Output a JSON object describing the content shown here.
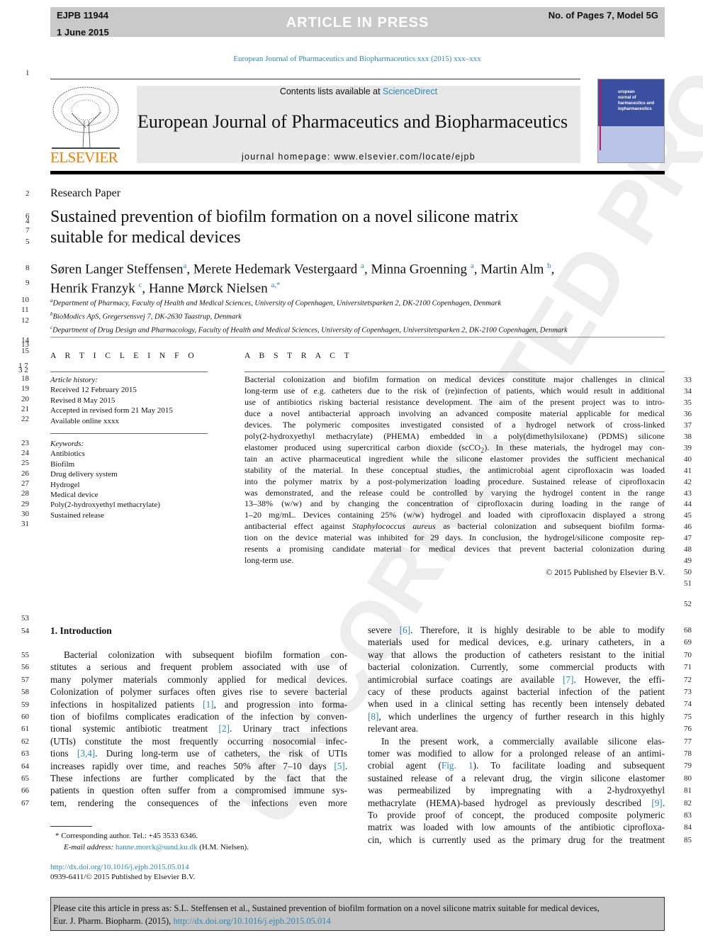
{
  "header": {
    "code": "EJPB 11944",
    "date": "1 June 2015",
    "status": "ARTICLE IN PRESS",
    "pages": "No. of Pages 7, Model 5G"
  },
  "journal_ref": "European Journal of Pharmaceutics and Biopharmaceutics xxx (2015) xxx–xxx",
  "masthead": {
    "contents_prefix": "Contents lists available at ",
    "sciencedirect": "ScienceDirect",
    "journal_name": "European Journal of Pharmaceutics and Biopharmaceutics",
    "homepage": "journal homepage: www.elsevier.com/locate/ejpb",
    "publisher_logo": "ELSEVIER",
    "cover_title": [
      "uropean",
      "ournal of",
      "harmaceutics and",
      "iopharmaceutics"
    ]
  },
  "colors": {
    "link": "#2a87b8",
    "elsevier_orange": "#f07d00",
    "cover_blue": "#3b4fa0",
    "cover_light": "#b9c4e6"
  },
  "watermark": "UNCORRECTED PROOF",
  "article_type": "Research Paper",
  "title": [
    "Sustained prevention of biofilm formation on a novel silicone matrix",
    "suitable for medical devices"
  ],
  "authors": [
    [
      {
        "t": "Søren Langer Steffensen"
      },
      {
        "sup": "a"
      },
      {
        "t": ", Merete Hedemark Vestergaard "
      },
      {
        "sup": "a"
      },
      {
        "t": ", Minna Groenning "
      },
      {
        "sup": "a"
      },
      {
        "t": ", Martin Alm "
      },
      {
        "sup": "b"
      },
      {
        "t": ","
      }
    ],
    [
      {
        "t": "Henrik Franzyk "
      },
      {
        "sup": "c"
      },
      {
        "t": ", Hanne Mørck Nielsen "
      },
      {
        "sup": "a,*"
      }
    ]
  ],
  "affiliations": [
    {
      "mark": "a",
      "text": "Department of Pharmacy, Faculty of Health and Medical Sciences, University of Copenhagen, Universitetsparken 2, DK-2100 Copenhagen, Denmark"
    },
    {
      "mark": "b",
      "text": "BioModics ApS, Gregersensvej 7, DK-2630 Taastrup, Denmark"
    },
    {
      "mark": "c",
      "text": "Department of Drug Design and Pharmacology, Faculty of Health and Medical Sciences, University of Copenhagen, Universitetsparken 2, DK-2100 Copenhagen, Denmark"
    }
  ],
  "article_info": {
    "heading": "A R T I C L E   I N F O",
    "history_label": "Article history:",
    "history": [
      "Received 12 February 2015",
      "Revised 8 May 2015",
      "Accepted in revised form 21 May 2015",
      "Available online xxxx"
    ],
    "keywords_label": "Keywords:",
    "keywords": [
      "Antibiotics",
      "Biofilm",
      "Drug delivery system",
      "Hydrogel",
      "Medical device",
      "Poly(2-hydroxyethyl methacrylate)",
      "Sustained release"
    ]
  },
  "abstract": {
    "heading": "A B S T R A C T",
    "copyright": "© 2015 Published by Elsevier B.V.",
    "lines": [
      {
        "n": "33",
        "s": [
          "Bacterial colonization and biofilm formation on medical devices constitute major challenges in clinical"
        ]
      },
      {
        "n": "34",
        "s": [
          "long-term use of e.g. catheters due to the risk of (re)infection of patients, which would result in additional"
        ]
      },
      {
        "n": "35",
        "s": [
          "use of antibiotics risking bacterial resistance development. The aim of the present project was to intro-"
        ]
      },
      {
        "n": "36",
        "s": [
          "duce a novel antibacterial approach involving an advanced composite material applicable for medical"
        ]
      },
      {
        "n": "37",
        "s": [
          "devices. The polymeric composites investigated consisted of a hydrogel network of cross-linked"
        ]
      },
      {
        "n": "38",
        "s": [
          "poly(2-hydroxyethyl methacrylate) (PHEMA) embedded in a poly(dimethylsiloxane) (PDMS) silicone"
        ]
      },
      {
        "n": "39",
        "s": [
          "elastomer produced using supercritical carbon dioxide (scCO",
          {
            "sub": "2"
          },
          "). In these materials, the hydrogel may con-"
        ]
      },
      {
        "n": "40",
        "s": [
          "tain an active pharmaceutical ingredient while the silicone elastomer provides the sufficient mechanical"
        ]
      },
      {
        "n": "41",
        "s": [
          "stability of the material. In these conceptual studies, the antimicrobial agent ciprofloxacin was loaded"
        ]
      },
      {
        "n": "42",
        "s": [
          "into the polymer matrix by a post-polymerization loading procedure. Sustained release of ciprofloxacin"
        ]
      },
      {
        "n": "43",
        "s": [
          "was demonstrated, and the release could be controlled by varying the hydrogel content in the range"
        ]
      },
      {
        "n": "44",
        "s": [
          "13–38% (w/w) and by changing the concentration of ciprofloxacin during loading in the range of"
        ]
      },
      {
        "n": "45",
        "s": [
          "1–20 mg/mL. Devices containing 25% (w/w) hydrogel and loaded with ciprofloxacin displayed a strong"
        ]
      },
      {
        "n": "46",
        "s": [
          "antibacterial effect against ",
          {
            "i": "Staphylococcus aureus"
          },
          " as bacterial colonization and subsequent biofilm forma-"
        ]
      },
      {
        "n": "47",
        "s": [
          "tion on the device material was inhibited for 29 days. In conclusion, the hydrogel/silicone composite rep-"
        ]
      },
      {
        "n": "48",
        "s": [
          "resents a promising candidate material for medical devices that prevent bacterial colonization during"
        ]
      },
      {
        "n": "49",
        "s": [
          "long-term use."
        ],
        "last": true
      }
    ]
  },
  "intro": {
    "heading": "1. Introduction",
    "left": [
      {
        "n": "55",
        "s": [
          "Bacterial colonization with subsequent biofilm formation con-"
        ],
        "ind": true
      },
      {
        "n": "56",
        "s": [
          "stitutes a serious and frequent problem associated with use of"
        ]
      },
      {
        "n": "57",
        "s": [
          "many polymer materials commonly applied for medical devices."
        ]
      },
      {
        "n": "58",
        "s": [
          "Colonization of polymer surfaces often gives rise to severe bacterial"
        ]
      },
      {
        "n": "59",
        "s": [
          "infections in hospitalized patients ",
          {
            "link": "[1]"
          },
          ", and progression into forma-"
        ]
      },
      {
        "n": "60",
        "s": [
          "tion of biofilms complicates eradication of the infection by conven-"
        ]
      },
      {
        "n": "61",
        "s": [
          "tional systemic antibiotic treatment ",
          {
            "link": "[2]"
          },
          ". Urinary tract infections"
        ]
      },
      {
        "n": "62",
        "s": [
          "(UTIs) constitute the most frequently occurring nosocomial infec-"
        ]
      },
      {
        "n": "63",
        "s": [
          "tions ",
          {
            "link": "[3,4]"
          },
          ". During long-term use of catheters, the risk of UTIs"
        ]
      },
      {
        "n": "64",
        "s": [
          "increases rapidly over time, and reaches 50% after 7–10 days ",
          {
            "link": "[5]"
          },
          "."
        ]
      },
      {
        "n": "65",
        "s": [
          "These infections are further complicated by the fact that the"
        ]
      },
      {
        "n": "66",
        "s": [
          "patients in question often suffer from a compromised immune sys-"
        ]
      },
      {
        "n": "67",
        "s": [
          "tem, rendering the consequences of the infections even more"
        ]
      }
    ],
    "right": [
      {
        "n": "68",
        "s": [
          "severe ",
          {
            "link": "[6]"
          },
          ". Therefore, it is highly desirable to be able to modify"
        ]
      },
      {
        "n": "69",
        "s": [
          "materials used for medical devices, e.g. urinary catheters, in a"
        ]
      },
      {
        "n": "70",
        "s": [
          "way that allows the production of catheters resistant to the initial"
        ]
      },
      {
        "n": "71",
        "s": [
          "bacterial colonization. Currently, some commercial products with"
        ]
      },
      {
        "n": "72",
        "s": [
          "antimicrobial surface coatings are available ",
          {
            "link": "[7]"
          },
          ". However, the effi-"
        ]
      },
      {
        "n": "73",
        "s": [
          "cacy of these products against bacterial infection of the patient"
        ]
      },
      {
        "n": "74",
        "s": [
          "when used in a clinical setting has recently been intensely debated"
        ]
      },
      {
        "n": "75",
        "s": [
          {
            "link": "[8]"
          },
          ", which underlines the urgency of further research in this highly"
        ]
      },
      {
        "n": "76",
        "s": [
          "relevant area."
        ],
        "last": true
      },
      {
        "n": "77",
        "s": [
          "In the present work, a commercially available silicone elas-"
        ],
        "ind": true
      },
      {
        "n": "78",
        "s": [
          "tomer was modified to allow for a prolonged release of an antimi-"
        ]
      },
      {
        "n": "79",
        "s": [
          "crobial agent (",
          {
            "link": "Fig. 1"
          },
          "). To facilitate loading and subsequent"
        ]
      },
      {
        "n": "80",
        "s": [
          "sustained release of a relevant drug, the virgin silicone elastomer"
        ]
      },
      {
        "n": "81",
        "s": [
          "was permeabilized by impregnating with a 2-hydroxyethyl"
        ]
      },
      {
        "n": "82",
        "s": [
          "methacrylate (HEMA)-based hydrogel as previously described ",
          {
            "link": "[9]"
          },
          "."
        ]
      },
      {
        "n": "83",
        "s": [
          "To provide proof of concept, the produced composite polymeric"
        ]
      },
      {
        "n": "84",
        "s": [
          "matrix was loaded with low amounts of the antibiotic ciprofloxa-"
        ]
      },
      {
        "n": "85",
        "s": [
          "cin, which is currently used as the primary drug for the treatment"
        ]
      }
    ]
  },
  "footnote": {
    "star": "*",
    "corresponding": "Corresponding author. Tel.: +45 3533 6346.",
    "email_label": "E-mail address: ",
    "email": "hanne.morck@sund.ku.dk",
    "email_suffix": " (H.M. Nielsen)."
  },
  "doi": "http://dx.doi.org/10.1016/j.ejpb.2015.05.014",
  "issn": "0939-6411/© 2015 Published by Elsevier B.V.",
  "cite_box": {
    "text": "Please cite this article in press as: S.L. Steffensen et al., Sustained prevention of biofilm formation on a novel silicone matrix suitable for medical devices,",
    "text2": "Eur. J. Pharm. Biopharm. (2015), ",
    "doi": "http://dx.doi.org/10.1016/j.ejpb.2015.05.014"
  },
  "margin_numbers": [
    "1",
    "2",
    "6",
    "4",
    "7",
    "5",
    "8",
    "9",
    "10",
    "11",
    "12",
    "14",
    "13",
    "15",
    "1 7",
    "3 2",
    "18",
    "19",
    "20",
    "21",
    "22",
    "23",
    "24",
    "25",
    "26",
    "27",
    "28",
    "29",
    "30",
    "31",
    "50",
    "51",
    "52",
    "53",
    "54"
  ]
}
